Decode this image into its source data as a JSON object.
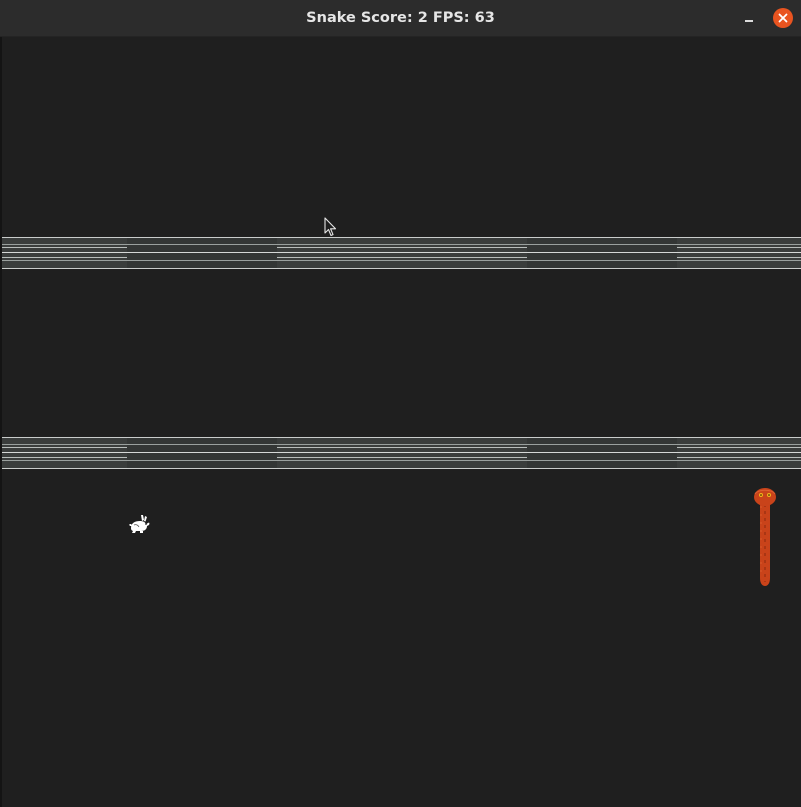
{
  "window": {
    "title": "Snake Score: 2 FPS: 63",
    "minimize_label": "–",
    "close_icon": "close-icon",
    "accent_close": "#e95420"
  },
  "game": {
    "score": 2,
    "fps": 63,
    "background": "#1f1f1f",
    "road_color": "#3a3d3c",
    "snake_color": "#c9431a",
    "roads": 2,
    "entities": [
      "rabbit-sprite",
      "snake-sprite"
    ]
  }
}
